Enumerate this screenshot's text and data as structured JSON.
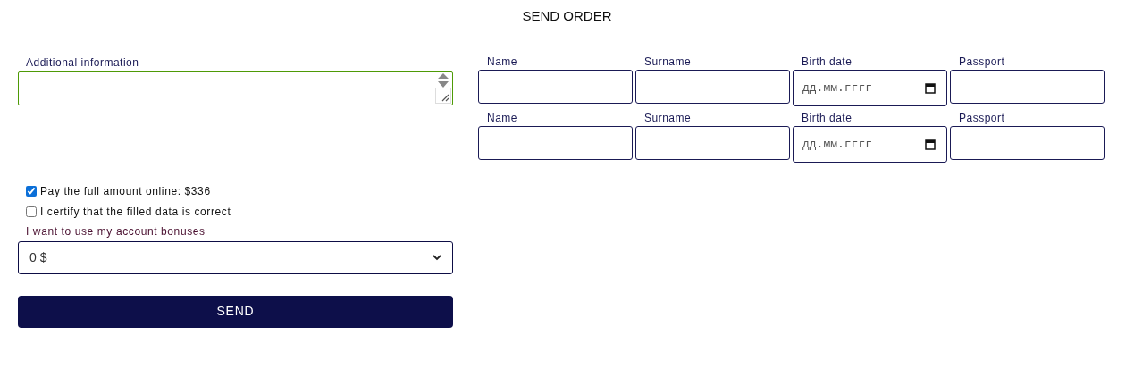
{
  "title": "SEND ORDER",
  "additional_information": {
    "label": "Additional information"
  },
  "passengers": [
    {
      "fields": [
        {
          "kind": "text",
          "label": "Name"
        },
        {
          "kind": "text",
          "label": "Surname"
        },
        {
          "kind": "date",
          "label": "Birth date",
          "placeholder": "дд.мм.гггг"
        },
        {
          "kind": "text",
          "label": "Passport"
        }
      ]
    },
    {
      "fields": [
        {
          "kind": "text",
          "label": "Name"
        },
        {
          "kind": "text",
          "label": "Surname"
        },
        {
          "kind": "date",
          "label": "Birth date",
          "placeholder": "дд.мм.гггг"
        },
        {
          "kind": "text",
          "label": "Passport"
        }
      ]
    }
  ],
  "checkboxes": [
    {
      "label": "Pay the full amount online: $336",
      "checked": true
    },
    {
      "label": "I certify that the filled data is correct",
      "checked": false
    }
  ],
  "bonuses": {
    "label": "I want to use my account bonuses",
    "value": "0 $"
  },
  "send_button": "SEND"
}
